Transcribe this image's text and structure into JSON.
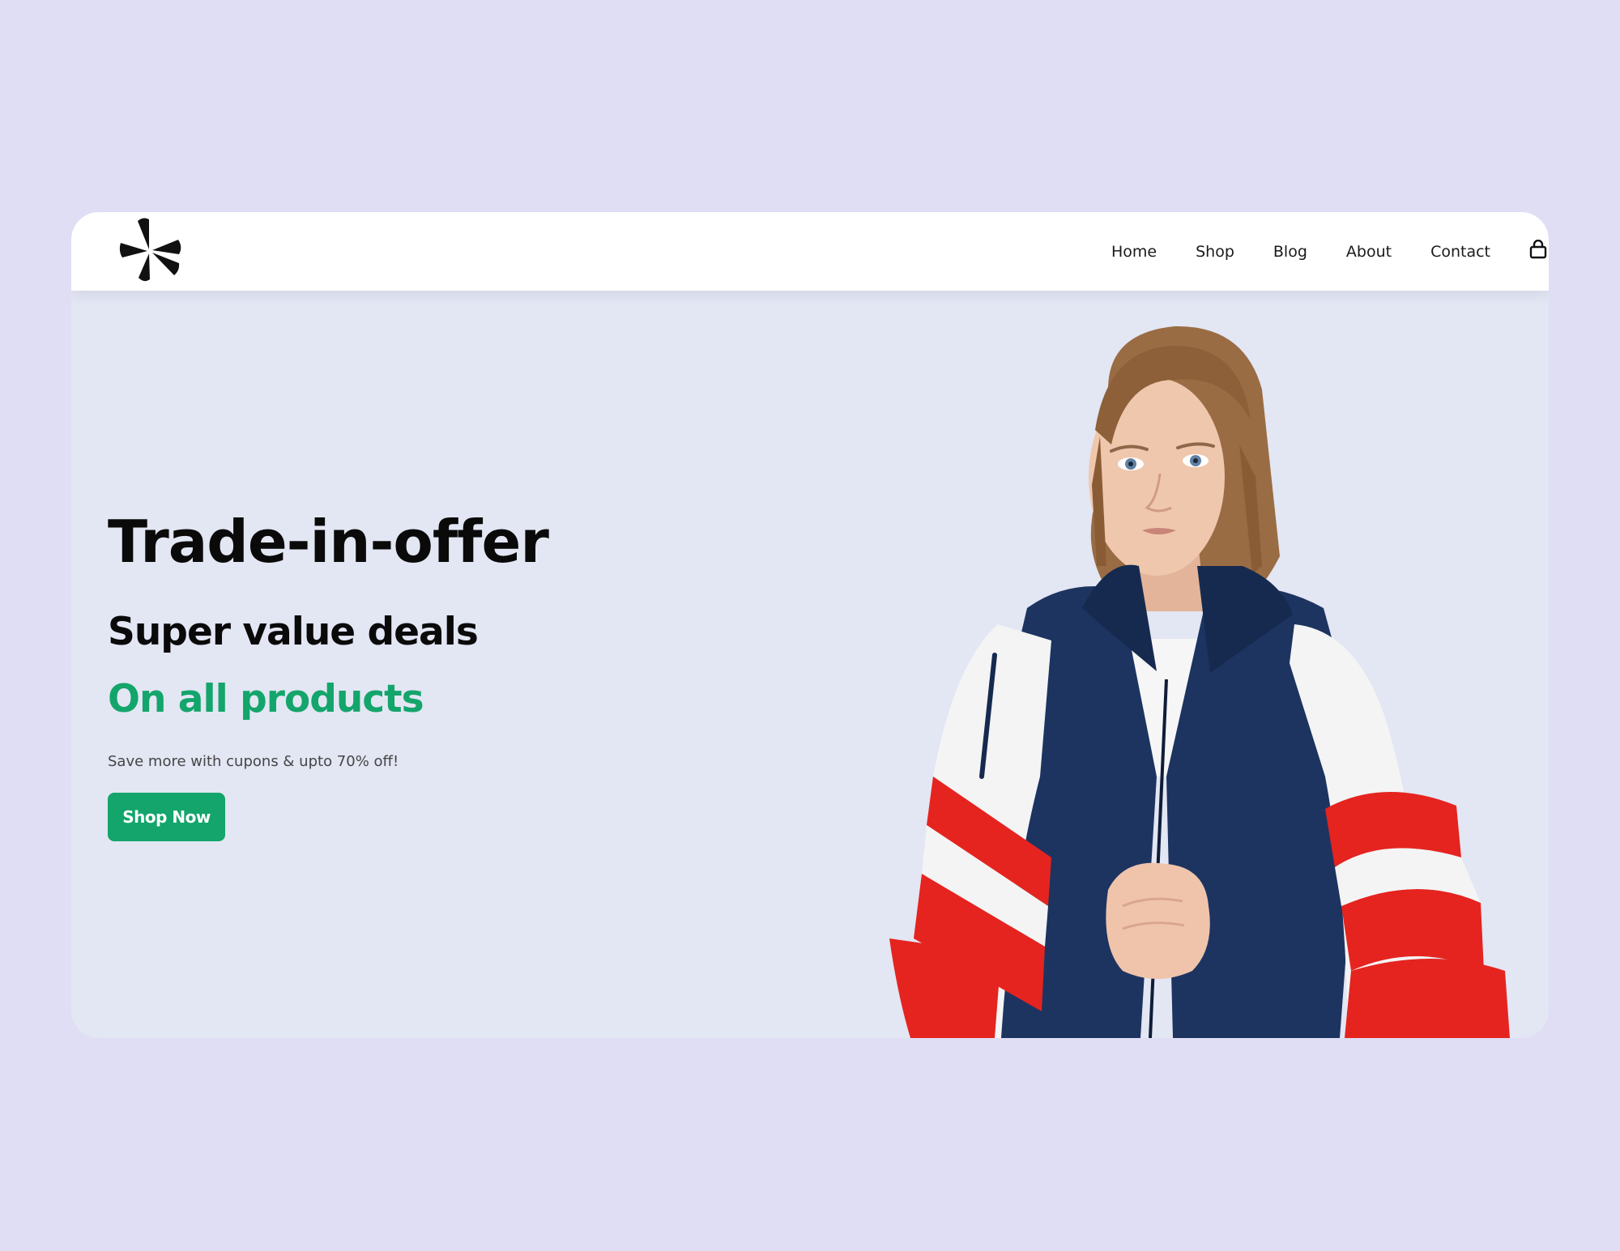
{
  "nav": {
    "logo_icon": "starburst-logo-icon",
    "links": [
      {
        "label": "Home"
      },
      {
        "label": "Shop"
      },
      {
        "label": "Blog"
      },
      {
        "label": "About"
      },
      {
        "label": "Contact"
      }
    ],
    "cart_icon": "shopping-bag-icon"
  },
  "hero": {
    "title": "Trade-in-offer",
    "subtitle": "Super value deals",
    "highlight": "On all products",
    "description": "Save more with cupons & upto 70% off!",
    "cta_label": "Shop Now",
    "image_icon": "model-photo"
  },
  "colors": {
    "page_background": "#e0def5",
    "hero_background": "#e3e6f3",
    "accent_green": "#13a56b",
    "text_dark": "#0a0a0a",
    "jacket_navy": "#1d3461",
    "jacket_red": "#e52420"
  }
}
